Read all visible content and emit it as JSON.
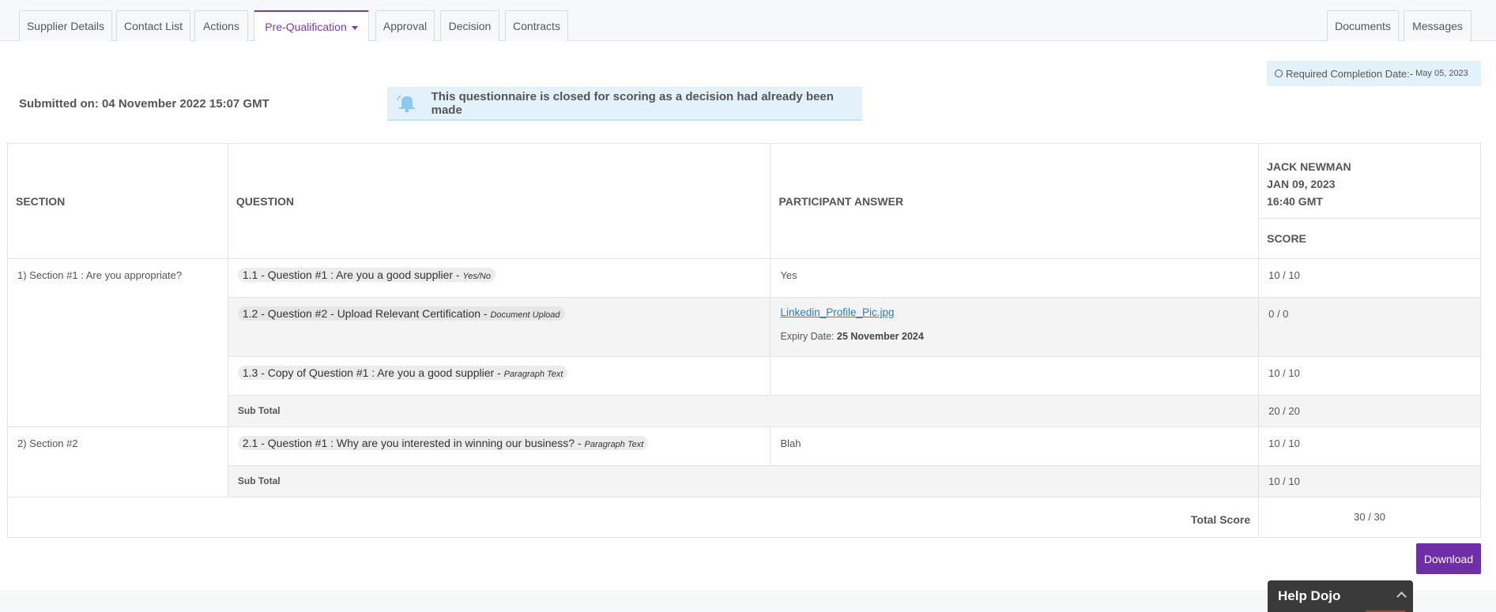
{
  "tabs": {
    "supplier_details": "Supplier Details",
    "contact_list": "Contact List",
    "actions": "Actions",
    "prequalification": "Pre-Qualification",
    "approval": "Approval",
    "decision": "Decision",
    "contracts": "Contracts",
    "documents": "Documents",
    "messages": "Messages"
  },
  "required_completion": {
    "label": "Required Completion Date:-",
    "date": "May 05, 2023"
  },
  "submitted": "Submitted on: 04 November 2022 15:07 GMT",
  "notice": "This questionnaire is closed for scoring as a decision had already been made",
  "table": {
    "headers": {
      "section": "SECTION",
      "question": "QUESTION",
      "answer": "PARTICIPANT ANSWER",
      "scorer_name": "JACK NEWMAN",
      "scorer_date": "JAN 09, 2023",
      "scorer_time": "16:40 GMT",
      "score": "SCORE"
    },
    "sections": [
      {
        "label": "1) Section #1 : Are you appropriate?",
        "questions": [
          {
            "text": "1.1 - Question #1 : Are you a good supplier -",
            "type": "Yes/No",
            "answer": "Yes",
            "score": "10 / 10"
          },
          {
            "text": "1.2 - Question #2 - Upload Relevant Certification -",
            "type": "Document Upload",
            "answer_link": "Linkedin_Profile_Pic.jpg",
            "expiry_label": "Expiry Date:",
            "expiry_value": "25 November 2024",
            "score": "0 / 0"
          },
          {
            "text": "1.3 - Copy of Question #1 : Are you a good supplier -",
            "type": "Paragraph Text",
            "answer": "",
            "score": "10 / 10"
          }
        ],
        "subtotal_label": "Sub Total",
        "subtotal": "20 / 20"
      },
      {
        "label": "2) Section #2",
        "questions": [
          {
            "text": "2.1 - Question #1 : Why are you interested in winning our business? -",
            "type": "Paragraph Text",
            "answer": "Blah",
            "score": "10 / 10"
          }
        ],
        "subtotal_label": "Sub Total",
        "subtotal": "10 / 10"
      }
    ],
    "total_label": "Total Score",
    "total": "30 / 30"
  },
  "download_label": "Download",
  "help_dojo_label": "Help Dojo",
  "colors": {
    "accent": "#6f2da8",
    "notice_bg": "#e3f1fb",
    "link": "#2a7bc8"
  }
}
